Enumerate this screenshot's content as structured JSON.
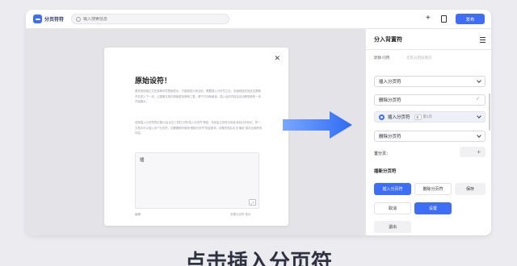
{
  "app": {
    "name": "分页符符",
    "brand_color": "#3d6ef5",
    "search_placeholder": "输入搜索信息",
    "primary_button": "发布"
  },
  "document": {
    "title": "原始设符！",
    "paragraph1": "原来的段落正文在各种环境里面显示。只能够显示到当前，需要插入分页符之后，页面就能在指定位置断开并进入下一页，让整篇文档的排版更加清晰工整，便于打印和阅读。插入后的内容会自动移到新的一页开始展示。",
    "paragraph2": "选择插入分页符的位置(1)后点击工具栏中的“插入分页符”按钮，系统会立即在光标处添加分页标记，同一文档中可以插入多个分页符，如需撤销可使用“删除分页符”恢复原状。设置完成后点击“确定”保存全部修改内容。",
    "input_text": "插",
    "footer_left": "编辑",
    "footer_right": "查看分页符 显示"
  },
  "sidebar": {
    "title": "分入背置符",
    "subtitle": "默静 问用",
    "subtitle_hint": "尤其分割段落页",
    "select1": "插入分页符",
    "select2": "删除分页符",
    "select2_check": "✓",
    "select3": "插入分页符",
    "select3_pill": "B",
    "select3_note": "第1页",
    "select4": "删除分页符",
    "row_label": "置分页：",
    "row_plus": "+",
    "section_label": "插新分页符",
    "buttons": [
      "插入分页符",
      "删除分页符",
      "保存",
      "取消",
      "设置",
      "退出"
    ]
  },
  "caption": "点击插入分页符"
}
